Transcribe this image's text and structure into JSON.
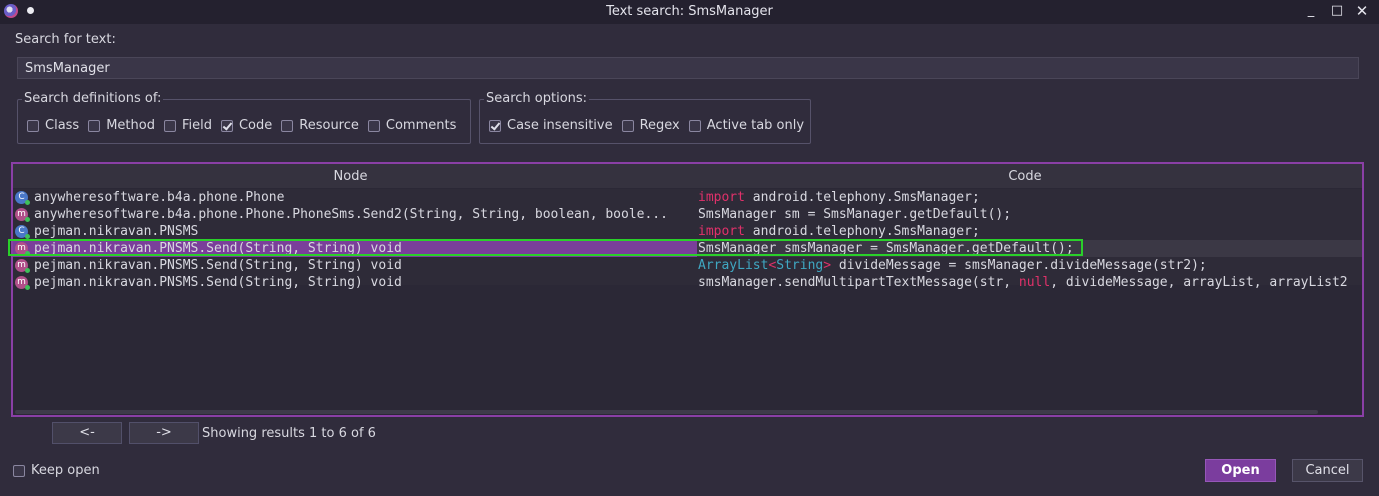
{
  "window": {
    "title": "Text search: SmsManager",
    "minimize": "_",
    "maximize": "□",
    "close": "✕"
  },
  "search": {
    "label": "Search for text:",
    "value": "SmsManager"
  },
  "definitions": {
    "legend": "Search definitions of:",
    "options": [
      {
        "label": "Class",
        "checked": false
      },
      {
        "label": "Method",
        "checked": false
      },
      {
        "label": "Field",
        "checked": false
      },
      {
        "label": "Code",
        "checked": true
      },
      {
        "label": "Resource",
        "checked": false
      },
      {
        "label": "Comments",
        "checked": false
      }
    ]
  },
  "search_options": {
    "legend": "Search options:",
    "options": [
      {
        "label": "Case insensitive",
        "checked": true
      },
      {
        "label": "Regex",
        "checked": false
      },
      {
        "label": "Active tab only",
        "checked": false
      }
    ]
  },
  "results": {
    "columns": {
      "node": "Node",
      "code": "Code"
    },
    "rows": [
      {
        "icon": "class-icon",
        "icon_letter": "C",
        "node": "anywheresoftware.b4a.phone.Phone",
        "code": [
          {
            "t": "import",
            "c": "kw"
          },
          {
            "t": " android.telephony.SmsManager;",
            "c": ""
          }
        ]
      },
      {
        "icon": "method-icon",
        "icon_letter": "m",
        "node": "anywheresoftware.b4a.phone.Phone.PhoneSms.Send2(String, String, boolean, boole...",
        "code": [
          {
            "t": "SmsManager sm = SmsManager.getDefault();",
            "c": ""
          }
        ]
      },
      {
        "icon": "class-icon",
        "icon_letter": "C",
        "node": "pejman.nikravan.PNSMS",
        "code": [
          {
            "t": "import",
            "c": "kw"
          },
          {
            "t": " android.telephony.SmsManager;",
            "c": ""
          }
        ]
      },
      {
        "icon": "method-icon",
        "icon_letter": "m",
        "node": "pejman.nikravan.PNSMS.Send(String, String) void",
        "selected": true,
        "code": [
          {
            "t": "SmsManager smsManager = SmsManager.getDefault();",
            "c": ""
          }
        ]
      },
      {
        "icon": "method-icon",
        "icon_letter": "m",
        "node": "pejman.nikravan.PNSMS.Send(String, String) void",
        "code": [
          {
            "t": "ArrayList",
            "c": "tp"
          },
          {
            "t": "<",
            "c": "kw"
          },
          {
            "t": "String",
            "c": "tp"
          },
          {
            "t": ">",
            "c": "kw"
          },
          {
            "t": " divideMessage = smsManager.divideMessage(str2);",
            "c": ""
          }
        ]
      },
      {
        "icon": "method-icon",
        "icon_letter": "m",
        "node": "pejman.nikravan.PNSMS.Send(String, String) void",
        "code": [
          {
            "t": "smsManager.sendMultipartTextMessage(str, ",
            "c": ""
          },
          {
            "t": "null",
            "c": "kw"
          },
          {
            "t": ", divideMessage, arrayList, arrayList2",
            "c": ""
          }
        ]
      }
    ]
  },
  "pager": {
    "prev": "<-",
    "next": "->",
    "status": "Showing results 1 to 6 of 6"
  },
  "keep_open": {
    "label": "Keep open",
    "checked": false
  },
  "buttons": {
    "open": "Open",
    "cancel": "Cancel"
  },
  "colors": {
    "accent": "#7b3d9e",
    "keyword": "#e0316a",
    "type": "#3fa7c2",
    "highlight": "#2ad02a"
  }
}
